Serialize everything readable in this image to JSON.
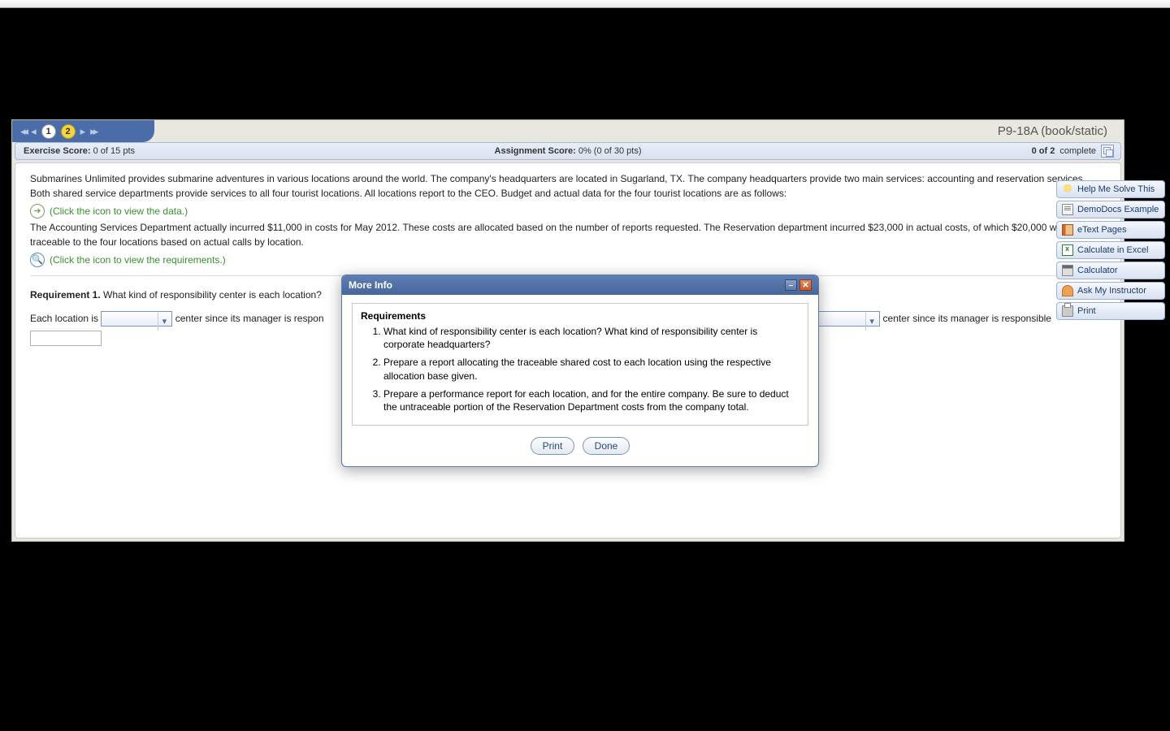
{
  "pageTitle": "P9-18A (book/static)",
  "nav": {
    "current": "1",
    "next": "2"
  },
  "scoreBar": {
    "exerciseLabel": "Exercise Score:",
    "exerciseValue": "0 of 15 pts",
    "assignmentLabel": "Assignment Score:",
    "assignmentValue": "0% (0 of 30 pts)",
    "progressCount": "0 of 2",
    "progressWord": "complete"
  },
  "problem": {
    "p1": "Submarines Unlimited provides submarine adventures in various locations around the world. The company's headquarters are located in Sugarland, TX. The company headquarters provide two main services: accounting and reservation services. Both shared service departments provide services to all four tourist locations. All locations report to the CEO. Budget and actual data for the four tourist locations are as follows:",
    "link1": "(Click the icon to view the data.)",
    "p2": "The Accounting Services Department actually incurred $11,000 in costs for May 2012. These costs are allocated based on the number of reports requested. The Reservation department incurred $23,000 in actual costs, of which $20,000 were traceable to the four locations based on actual calls by location.",
    "link2": "(Click the icon to view the requirements.)"
  },
  "requirement": {
    "heading": "Requirement 1.",
    "text": "What kind of responsibility center is each location?",
    "line_seg1": "Each location is ",
    "line_seg2": " center since its manager is respon",
    "line_seg3": " center since its manager is responsible "
  },
  "modal": {
    "title": "More Info",
    "boxTitle": "Requirements",
    "items": [
      "What kind of responsibility center is each location? What kind of responsibility center is corporate headquarters?",
      "Prepare a report allocating the traceable shared cost to each location using the respective allocation base given.",
      "Prepare a performance report for each location, and for the entire company. Be sure to deduct the untraceable portion of the Reservation Department costs from the company total."
    ],
    "printBtn": "Print",
    "doneBtn": "Done"
  },
  "sidebar": [
    "Help Me Solve This",
    "DemoDocs Example",
    "eText Pages",
    "Calculate in Excel",
    "Calculator",
    "Ask My Instructor",
    "Print"
  ]
}
